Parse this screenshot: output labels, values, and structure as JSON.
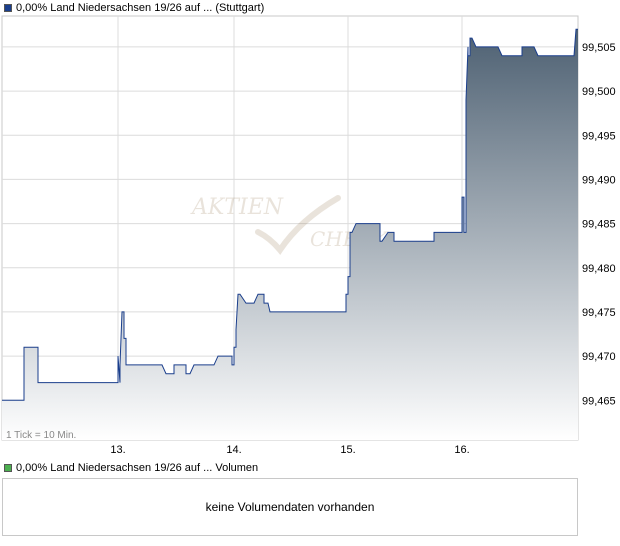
{
  "price_legend": {
    "label": "0,00% Land Niedersachsen 19/26 auf ... (Stuttgart)",
    "color": "#1a3e8c"
  },
  "volume_legend": {
    "label": "0,00% Land Niedersachsen 19/26 auf ... Volumen",
    "color": "#4caf50"
  },
  "tick_note": "1 Tick = 10 Min.",
  "watermark": {
    "word1": "AKTIEN",
    "word2": "CHECK"
  },
  "volume_message": "keine Volumendaten vorhanden",
  "colors": {
    "line": "#1a3e8c",
    "fill_top": "#4d6072",
    "fill_bottom": "#ffffff",
    "grid": "#dcdcdc"
  },
  "chart_data": {
    "type": "area",
    "title": "0,00% Land Niedersachsen 19/26 auf ... (Stuttgart)",
    "x_tick_labels": [
      "13.",
      "14.",
      "15.",
      "16."
    ],
    "y_tick_labels": [
      "99,465",
      "99,470",
      "99,475",
      "99,480",
      "99,485",
      "99,490",
      "99,495",
      "99,500",
      "99,505"
    ],
    "ylim": [
      99.4605,
      99.5085
    ],
    "grid": true,
    "x_unit": "ticks (1 Tick = 10 Min.)",
    "x_range": [
      0,
      288
    ],
    "x_day_starts": [
      58,
      116,
      173,
      230
    ],
    "series": [
      {
        "x": [
          0,
          11,
          11,
          12,
          14,
          16,
          18,
          18,
          58,
          58,
          59,
          59,
          60,
          61,
          61,
          62,
          62,
          64,
          64,
          80,
          80,
          82,
          83,
          86,
          86,
          87,
          89,
          92,
          92,
          94,
          96,
          106,
          106,
          108,
          108,
          115,
          115,
          116,
          116,
          117,
          117,
          118,
          119,
          122,
          126,
          126,
          128,
          131,
          131,
          133,
          134,
          172,
          172,
          173,
          173,
          174,
          174,
          175,
          177,
          179,
          179,
          189,
          189,
          190,
          193,
          196,
          196,
          199,
          201,
          216,
          216,
          230,
          230,
          231,
          231,
          232,
          232,
          233,
          233,
          234,
          234,
          235,
          237,
          238,
          240,
          248,
          250,
          260,
          260,
          262,
          264,
          266,
          268,
          286,
          286,
          287,
          288
        ],
        "y": [
          99.465,
          99.465,
          99.471,
          99.471,
          99.471,
          99.471,
          99.471,
          99.467,
          99.467,
          99.47,
          99.467,
          99.469,
          99.475,
          99.475,
          99.472,
          99.472,
          99.469,
          99.469,
          99.469,
          99.469,
          99.469,
          99.468,
          99.468,
          99.468,
          99.469,
          99.469,
          99.469,
          99.469,
          99.468,
          99.468,
          99.469,
          99.469,
          99.469,
          99.47,
          99.47,
          99.47,
          99.469,
          99.469,
          99.471,
          99.471,
          99.473,
          99.477,
          99.477,
          99.476,
          99.476,
          99.476,
          99.477,
          99.477,
          99.476,
          99.476,
          99.475,
          99.475,
          99.477,
          99.477,
          99.479,
          99.479,
          99.484,
          99.484,
          99.485,
          99.485,
          99.485,
          99.485,
          99.483,
          99.483,
          99.484,
          99.484,
          99.483,
          99.483,
          99.483,
          99.483,
          99.484,
          99.484,
          99.488,
          99.488,
          99.484,
          99.484,
          99.499,
          99.505,
          99.504,
          99.504,
          99.506,
          99.506,
          99.505,
          99.505,
          99.505,
          99.505,
          99.504,
          99.504,
          99.505,
          99.505,
          99.505,
          99.505,
          99.504,
          99.504,
          99.504,
          99.507,
          99.507
        ]
      }
    ]
  }
}
